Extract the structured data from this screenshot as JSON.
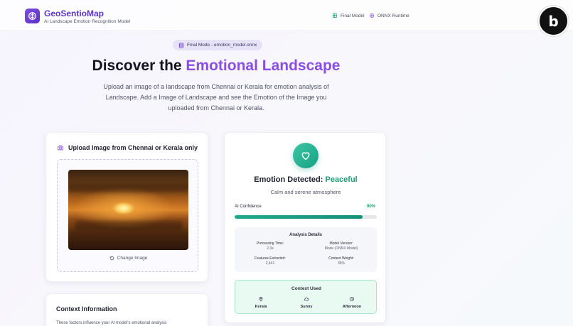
{
  "header": {
    "app_title": "GeoSentioMap",
    "app_subtitle": "AI Landscape Emotion Recognition Model",
    "nav": [
      {
        "label": "Final Model",
        "icon": "cube-icon"
      },
      {
        "label": "ONNX Runtime",
        "icon": "cpu-icon"
      }
    ]
  },
  "hero": {
    "mode_pill": "Final Mode - emotion_model.onnx",
    "title_prefix": "Discover the ",
    "title_accent": "Emotional Landscape",
    "description": "Upload an image of a landscape from Chennai or Kerala for emotion analysis of Landscape. Add a Image of Landscape and see the Emotion of the Image you uploaded from Chennai or Kerala."
  },
  "upload": {
    "title": "Upload Image from Chennai or Kerala only",
    "change_label": "Change Image"
  },
  "context_info": {
    "title": "Context Information",
    "description": "These factors influence your AI model's emotional analysis"
  },
  "result": {
    "emotion_prefix": "Emotion Detected: ",
    "emotion_value": "Peaceful",
    "emotion_desc": "Calm and serene atmosphere",
    "confidence_label": "AI Confidence",
    "confidence_text": "90%",
    "confidence_fraction": 0.9,
    "analysis": {
      "title": "Analysis Details",
      "processing_label": "Processing Time:",
      "processing_value": "2.3s",
      "model_label": "Model Version:",
      "model_value": "Mode (ONNX Model)",
      "features_label": "Features Extracted:",
      "features_value": "2,441",
      "weight_label": "Context Weight:",
      "weight_value": "35%"
    },
    "context_used": {
      "title": "Context Used",
      "items": [
        {
          "label": "Kerala",
          "icon": "location-pin-icon"
        },
        {
          "label": "Sunny",
          "icon": "cloud-icon"
        },
        {
          "label": "Afternoon",
          "icon": "clock-icon"
        }
      ]
    }
  },
  "colors": {
    "brand": "#5b34c9",
    "accent": "#8a4ee6",
    "success": "#1e9d72"
  }
}
